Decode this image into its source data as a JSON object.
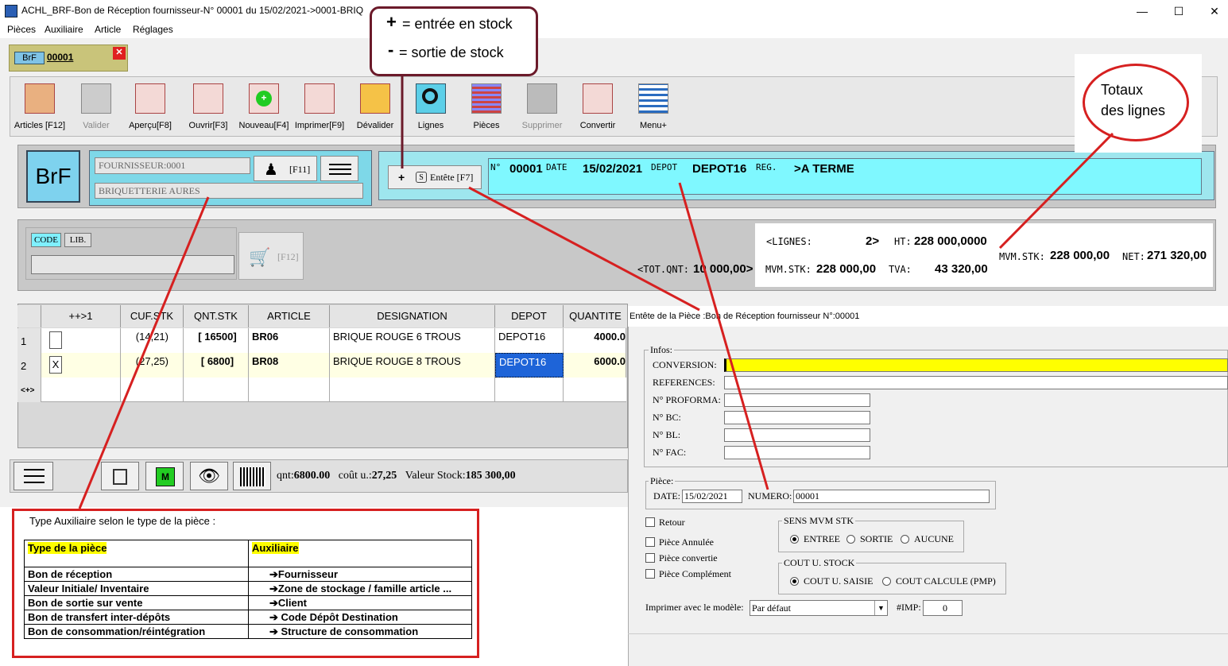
{
  "window": {
    "title": "ACHL_BRF-Bon de Réception fournisseur-N° 00001 du 15/02/2021->0001-BRIQUE",
    "minimize": "—",
    "maximize": "☐",
    "close": "✕"
  },
  "menu": [
    "Pièces",
    "Auxiliaire",
    "Article",
    "Réglages"
  ],
  "doc_tab": {
    "badge": "BrF",
    "number": "00001",
    "close": "✕"
  },
  "toolbar": [
    {
      "label": "Articles [F12]",
      "icon": "articles-icon"
    },
    {
      "label": "Valider",
      "icon": "validate-icon"
    },
    {
      "label": "Aperçu[F8]",
      "icon": "preview-icon"
    },
    {
      "label": "Ouvrir[F3]",
      "icon": "open-icon"
    },
    {
      "label": "Nouveau[F4]",
      "icon": "new-icon"
    },
    {
      "label": "Imprimer[F9]",
      "icon": "print-icon"
    },
    {
      "label": "Dévalider",
      "icon": "unvalidate-icon"
    },
    {
      "label": "Lignes",
      "icon": "lines-icon"
    },
    {
      "label": "Pièces",
      "icon": "pieces-icon"
    },
    {
      "label": "Supprimer",
      "icon": "delete-icon"
    },
    {
      "label": "Convertir",
      "icon": "convert-icon"
    },
    {
      "label": "Menu+",
      "icon": "menu-icon"
    }
  ],
  "header": {
    "brf_badge": "BrF",
    "fournisseur_label": "FOURNISSEUR",
    "fournisseur_code": "0001",
    "fournisseur_name": "BRIQUETTERIE AURES",
    "f11": "[F11]",
    "entete_plus": "+",
    "entete_s": "S",
    "entete_label": "Entête [F7]",
    "no_label": "N°",
    "no_value": "00001",
    "date_label": "DATE",
    "date_value": "15/02/2021",
    "depot_label": "DEPOT",
    "depot_value": "DEPOT16",
    "reg_label": "REG.",
    "reg_value": ">A TERME"
  },
  "search": {
    "code_tab": "CODE",
    "lib_tab": "LIB.",
    "f12": "[F12]"
  },
  "totals": {
    "lignes_label": "<LIGNES:",
    "lignes_value": "2>",
    "ht_label": "HT:",
    "ht_value": "228 000,0000",
    "totqnt_label": "<TOT.QNT:",
    "totqnt_value": "10 000,00>",
    "mvm_label": "MVM.STK:",
    "mvm_value": "228 000,00",
    "tva_label": "TVA:",
    "tva_value": "43 320,00",
    "mvm2_label": "MVM.STK:",
    "mvm2_value": "228 000,00",
    "net_label": "NET:",
    "net_value": "271 320,00"
  },
  "grid": {
    "columns": [
      "",
      "++>1",
      "CUF.STK",
      "QNT.STK",
      "ARTICLE",
      "DESIGNATION",
      "DEPOT",
      "QUANTITE"
    ],
    "rows": [
      {
        "num": "1",
        "check": "",
        "cuf": "(14,21)",
        "qnt": "[ 16500]",
        "article": "BR06",
        "designation": "BRIQUE ROUGE 6 TROUS",
        "depot": "DEPOT16",
        "quantite": "4000.0"
      },
      {
        "num": "2",
        "check": "X",
        "cuf": "(27,25)",
        "qnt": "[ 6800]",
        "article": "BR08",
        "designation": "BRIQUE ROUGE 8 TROUS",
        "depot": "DEPOT16",
        "quantite": "6000.0"
      }
    ],
    "new_row": "<+>"
  },
  "statusbar": {
    "qnt_label": "qnt:",
    "qnt_value": "6800.00",
    "cout_label": "coût u.:",
    "cout_value": "27,25",
    "valeur_label": "Valeur Stock:",
    "valeur_value": "185 300,00"
  },
  "dialog": {
    "title": "Entête de la Pièce :Bon de Réception fournisseur N°:00001",
    "infos_label": "Infos:",
    "conversion": "CONVERSION:",
    "references": "REFERENCES:",
    "proforma": "N° PROFORMA:",
    "bc": "N° BC:",
    "bl": "N° BL:",
    "fac": "N° FAC:",
    "piece_label": "Pièce:",
    "date_label": "DATE:",
    "date_value": "15/02/2021",
    "numero_label": "NUMERO:",
    "numero_value": "00001",
    "retour": "Retour",
    "annulee": "Pièce Annulée",
    "convertie": "Pièce convertie",
    "complement": "Pièce Complément",
    "sens_label": "SENS MVM STK",
    "entree": "ENTREE",
    "sortie": "SORTIE",
    "aucune": "AUCUNE",
    "cout_label": "COUT U. STOCK",
    "cout_saisie": "COUT U. SAISIE",
    "cout_calcule": "COUT CALCULE (PMP)",
    "imprimer_label": "Imprimer avec le modèle:",
    "modele_value": "Par défaut",
    "imp_label": "#IMP:",
    "imp_value": "0"
  },
  "annotations": {
    "stock_plus": "+",
    "stock_plus_text": "= entrée en stock",
    "stock_minus": "-",
    "stock_minus_text": "= sortie de stock",
    "totaux_1": "Totaux",
    "totaux_2": "des lignes",
    "type_title": "Type Auxiliaire  selon le type de la pièce :",
    "type_head_1": "Type de la pièce",
    "type_head_2": "Auxiliaire",
    "type_rows": [
      {
        "piece": "Bon de réception",
        "aux": "➔Fournisseur"
      },
      {
        "piece": "Valeur Initiale/ Inventaire",
        "aux": "➔Zone de stockage /  famille article ..."
      },
      {
        "piece": "Bon de sortie sur vente",
        "aux": "➔Client"
      },
      {
        "piece": "Bon de transfert inter-dépôts",
        "aux": "➔ Code Dépôt Destination"
      },
      {
        "piece": "Bon de consommation/réintégration",
        "aux": "➔  Structure de consommation"
      }
    ]
  },
  "colors": {
    "accent_red": "#d62020",
    "cyan": "#7ff8ff",
    "yellow": "#ffff00",
    "maroon": "#6b1a2a"
  }
}
